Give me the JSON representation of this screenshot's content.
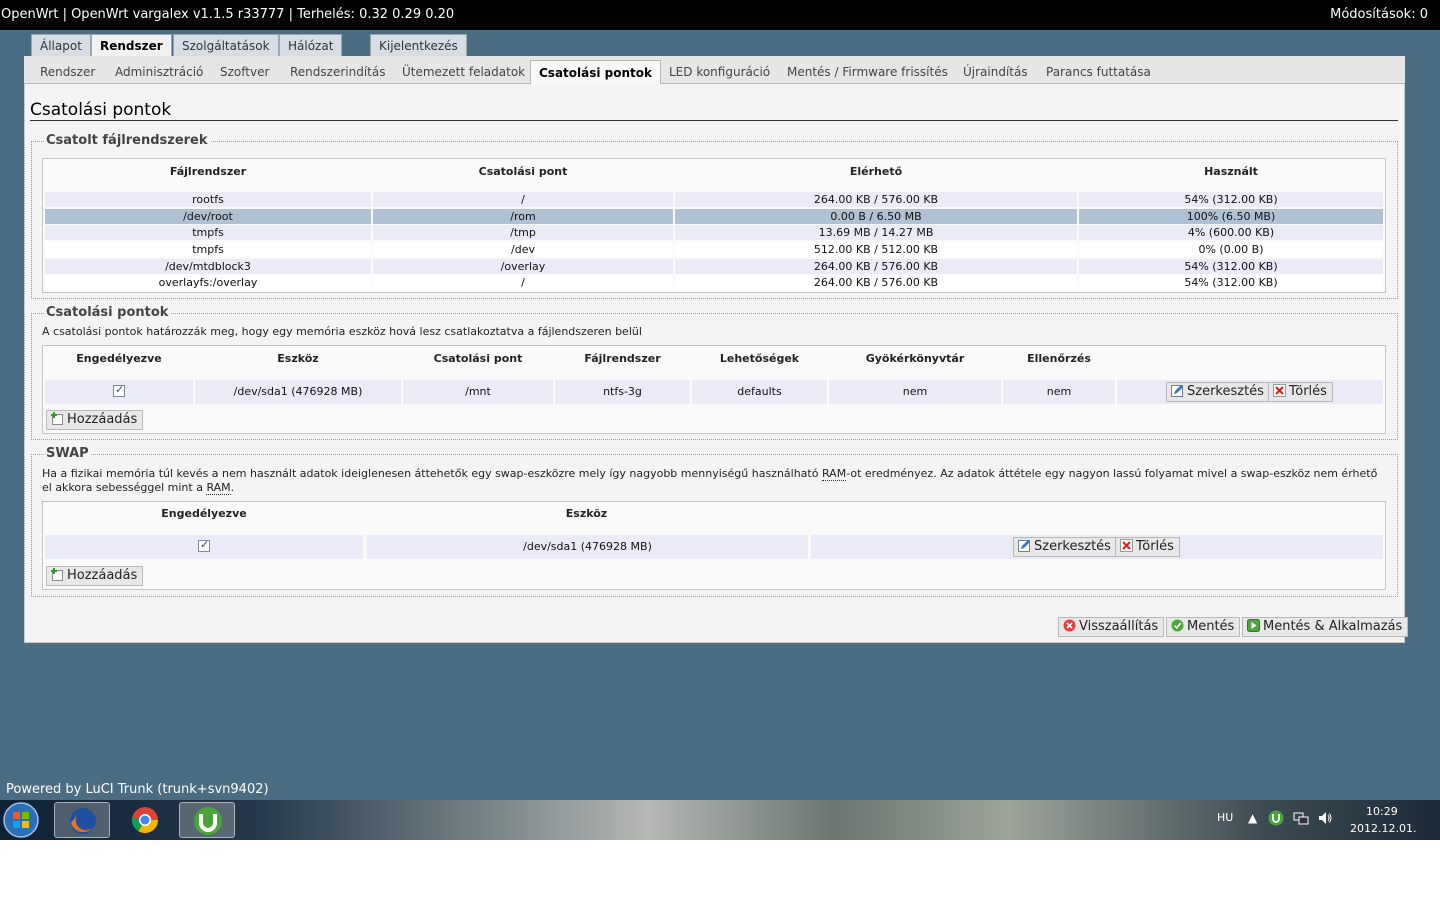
{
  "topbar": {
    "title": "OpenWrt | OpenWrt vargalex v1.1.5 r33777 | Terhelés: 0.32 0.29 0.20",
    "changes": "Módosítások: 0"
  },
  "main_tabs": [
    "Állapot",
    "Rendszer",
    "Szolgáltatások",
    "Hálózat",
    "Kijelentkezés"
  ],
  "sub_tabs": [
    "Rendszer",
    "Adminisztráció",
    "Szoftver",
    "Rendszerindítás",
    "Ütemezett feladatok",
    "Csatolási pontok",
    "LED konfiguráció",
    "Mentés / Firmware frissítés",
    "Újraindítás",
    "Parancs futtatása"
  ],
  "page_title": "Csatolási pontok",
  "mounted": {
    "legend": "Csatolt fájlrendszerek",
    "headers": [
      "Fájlrendszer",
      "Csatolási pont",
      "Elérhető",
      "Használt"
    ],
    "rows": [
      [
        "rootfs",
        "/",
        "264.00 KB / 576.00 KB",
        "54% (312.00 KB)"
      ],
      [
        "/dev/root",
        "/rom",
        "0.00 B / 6.50 MB",
        "100% (6.50 MB)"
      ],
      [
        "tmpfs",
        "/tmp",
        "13.69 MB / 14.27 MB",
        "4% (600.00 KB)"
      ],
      [
        "tmpfs",
        "/dev",
        "512.00 KB / 512.00 KB",
        "0% (0.00 B)"
      ],
      [
        "/dev/mtdblock3",
        "/overlay",
        "264.00 KB / 576.00 KB",
        "54% (312.00 KB)"
      ],
      [
        "overlayfs:/overlay",
        "/",
        "264.00 KB / 576.00 KB",
        "54% (312.00 KB)"
      ]
    ]
  },
  "mountpoints": {
    "legend": "Csatolási pontok",
    "description": "A csatolási pontok határozzák meg, hogy egy memória eszköz hová lesz csatlakoztatva a fájlendszeren belül",
    "headers": [
      "Engedélyezve",
      "Eszköz",
      "Csatolási pont",
      "Fájlrendszer",
      "Lehetőségek",
      "Gyökérkönyvtár",
      "Ellenőrzés"
    ],
    "row": {
      "device": "/dev/sda1 (476928 MB)",
      "mountpoint": "/mnt",
      "fs": "ntfs-3g",
      "options": "defaults",
      "root": "nem",
      "check": "nem"
    },
    "edit_label": "Szerkesztés",
    "delete_label": "Törlés",
    "add_label": "Hozzáadás"
  },
  "swap": {
    "legend": "SWAP",
    "desc_1": "Ha a fizikai memória túl kevés a nem használt adatok ideiglenesen áttehetők egy swap-eszközre mely így nagyobb mennyiségű használható ",
    "desc_ram_1": "RAM",
    "desc_2": "-ot eredményez. Az adatok áttétele egy nagyon lassú folyamat mivel a swap-eszköz nem érhető el akkora sebességgel mint a ",
    "desc_ram_2": "RAM",
    "desc_3": ".",
    "headers": [
      "Engedélyezve",
      "Eszköz"
    ],
    "row": {
      "device": "/dev/sda1 (476928 MB)"
    },
    "edit_label": "Szerkesztés",
    "delete_label": "Törlés",
    "add_label": "Hozzáadás"
  },
  "actions": {
    "reset": "Visszaállítás",
    "save": "Mentés",
    "save_apply": "Mentés & Alkalmazás"
  },
  "footer": {
    "powered_by": "Powered by LuCI Trunk (trunk+svn9402)"
  },
  "taskbar": {
    "lang": "HU",
    "time": "10:29",
    "date": "2012.12.01."
  },
  "colors": {
    "accent_selected_row": "#aec2d3",
    "row_stripe": "#ebebf7",
    "background": "#4a6d84"
  }
}
